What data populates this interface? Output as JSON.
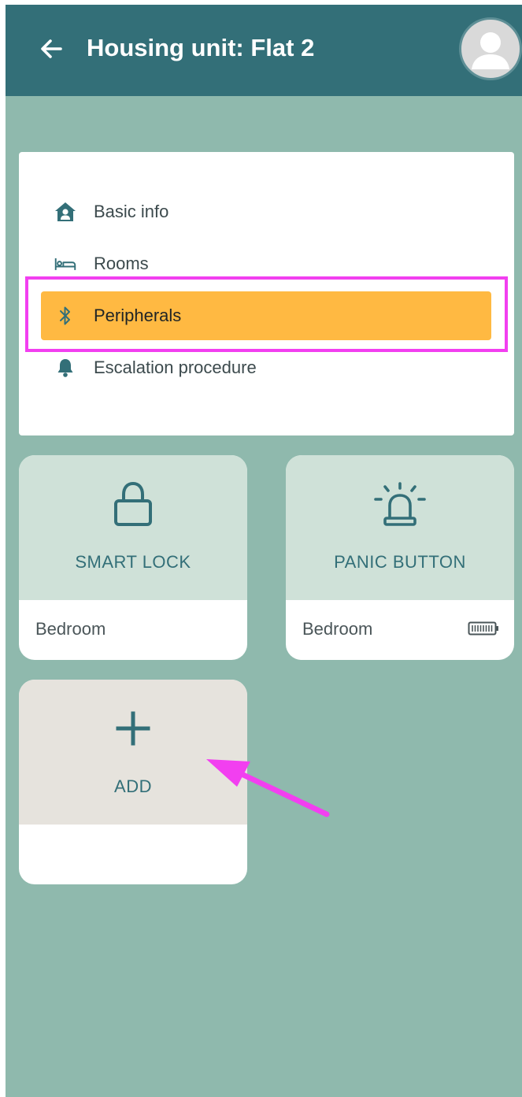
{
  "header": {
    "title": "Housing unit: Flat 2"
  },
  "menu": {
    "items": [
      {
        "label": "Basic info",
        "icon": "house-user-icon"
      },
      {
        "label": "Rooms",
        "icon": "bed-icon"
      },
      {
        "label": "Peripherals",
        "icon": "bluetooth-icon",
        "active": true
      },
      {
        "label": "Escalation procedure",
        "icon": "bell-icon"
      }
    ]
  },
  "devices": [
    {
      "label": "SMART LOCK",
      "room": "Bedroom",
      "icon": "lock-icon"
    },
    {
      "label": "PANIC BUTTON",
      "room": "Bedroom",
      "icon": "siren-icon",
      "status_icon": "battery-full-icon"
    }
  ],
  "add_tile": {
    "label": "ADD",
    "icon": "plus-icon"
  },
  "colors": {
    "header": "#336f78",
    "background": "#8fb9ad",
    "active_menu": "#ffb942",
    "tile_top": "#cfe1d8",
    "add_tile_top": "#e6e3dd",
    "annotation": "#f23ff0"
  }
}
